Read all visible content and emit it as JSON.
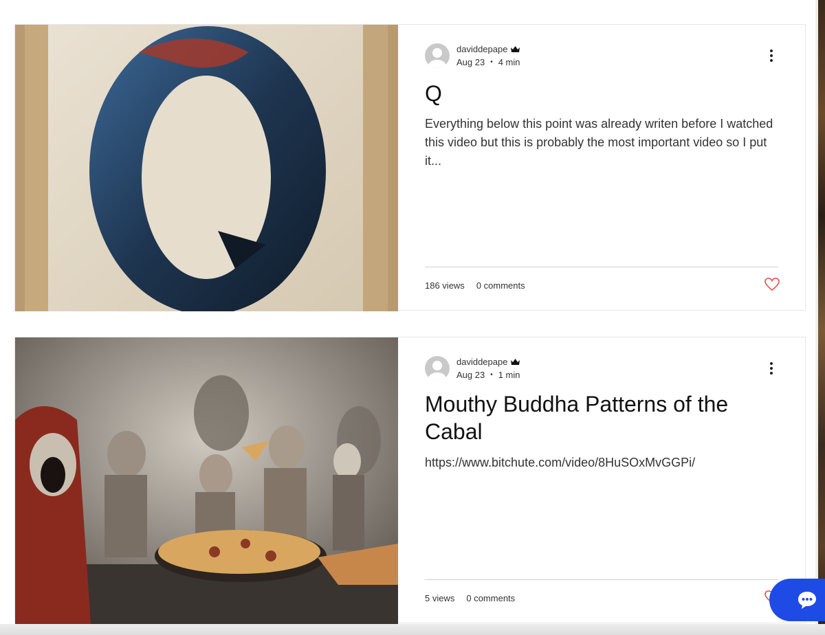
{
  "posts": [
    {
      "author": "daviddepape",
      "date": "Aug 23",
      "read_time": "4 min",
      "title": "Q",
      "excerpt": "Everything below this point was already writen before I watched this video but this is probably the most important video so I put it...",
      "views": "186 views",
      "comments": "0 comments",
      "image": "blue-letter-q-painting"
    },
    {
      "author": "daviddepape",
      "date": "Aug 23",
      "read_time": "1 min",
      "title": "Mouthy Buddha Patterns of the Cabal",
      "excerpt": "https://www.bitchute.com/video/8HuSOxMvGGPi/",
      "views": "5 views",
      "comments": "0 comments",
      "image": "dark-children-pizza-painting"
    }
  ],
  "icons": {
    "author_badge": "crown-icon",
    "more": "more-vertical-icon",
    "like": "heart-icon",
    "chat": "chat-icon"
  },
  "colors": {
    "like_heart": "#e8504d",
    "chat_button": "#1e4be6",
    "divider": "#cfcfcf"
  }
}
